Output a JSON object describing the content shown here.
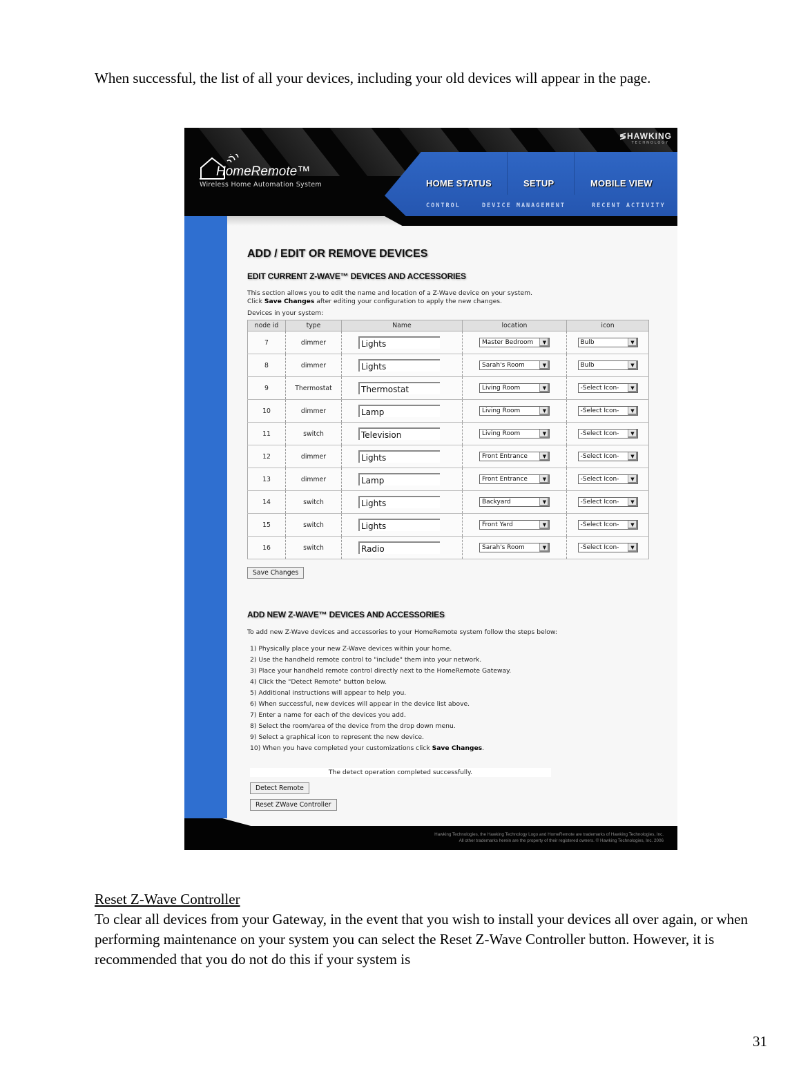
{
  "document": {
    "intro": "When successful, the list of all your devices, including your old devices will appear in the page.",
    "reset_heading": "Reset Z-Wave Controller",
    "reset_body": "To clear all devices from your Gateway, in the event that you wish to install your devices all over again, or when performing maintenance on your system you can select the Reset Z-Wave Controller button.  However, it is recommended that you do not do this if your system is",
    "page_number": "31"
  },
  "app": {
    "brand": "HAWKING",
    "brand_sub": "TECHNOLOGY",
    "logo": "HomeRemote™",
    "tagline": "Wireless Home Automation System",
    "nav": [
      {
        "label": "HOME STATUS",
        "sub": "CONTROL"
      },
      {
        "label": "SETUP",
        "sub": "DEVICE MANAGEMENT"
      },
      {
        "label": "MOBILE VIEW",
        "sub": "RECENT ACTIVITY"
      }
    ],
    "page_title": "ADD / EDIT OR REMOVE DEVICES",
    "edit_section": {
      "heading": "EDIT CURRENT Z-WAVE™ DEVICES AND ACCESSORIES",
      "desc_line1": "This section allows you to edit the name and location of a Z-Wave device on your system.",
      "desc_click": "Click ",
      "desc_bold": "Save Changes",
      "desc_rest": " after editing your configuration to apply the new changes.",
      "devices_label": "Devices in your system:",
      "columns": [
        "node id",
        "type",
        "Name",
        "location",
        "icon"
      ],
      "rows": [
        {
          "node": "7",
          "type": "dimmer",
          "name": "Lights",
          "location": "Master Bedroom",
          "icon": "Bulb"
        },
        {
          "node": "8",
          "type": "dimmer",
          "name": "Lights",
          "location": "Sarah's Room",
          "icon": "Bulb"
        },
        {
          "node": "9",
          "type": "Thermostat",
          "name": "Thermostat",
          "location": "Living Room",
          "icon": "-Select Icon-"
        },
        {
          "node": "10",
          "type": "dimmer",
          "name": "Lamp",
          "location": "Living Room",
          "icon": "-Select Icon-"
        },
        {
          "node": "11",
          "type": "switch",
          "name": "Television",
          "location": "Living Room",
          "icon": "-Select Icon-"
        },
        {
          "node": "12",
          "type": "dimmer",
          "name": "Lights",
          "location": "Front Entrance",
          "icon": "-Select Icon-"
        },
        {
          "node": "13",
          "type": "dimmer",
          "name": "Lamp",
          "location": "Front Entrance",
          "icon": "-Select Icon-"
        },
        {
          "node": "14",
          "type": "switch",
          "name": "Lights",
          "location": "Backyard",
          "icon": "-Select Icon-"
        },
        {
          "node": "15",
          "type": "switch",
          "name": "Lights",
          "location": "Front Yard",
          "icon": "-Select Icon-"
        },
        {
          "node": "16",
          "type": "switch",
          "name": "Radio",
          "location": "Sarah's Room",
          "icon": "-Select Icon-"
        }
      ],
      "save_button": "Save Changes"
    },
    "add_section": {
      "heading": "ADD NEW Z-WAVE™ DEVICES AND ACCESSORIES",
      "intro": "To add new Z-Wave devices and accessories to your HomeRemote system follow the steps below:",
      "steps": [
        "1) Physically place your new Z-Wave devices within your home.",
        "2) Use the handheld remote control to \"include\" them into your network.",
        "3) Place your handheld remote control directly next to the HomeRemote Gateway.",
        "4) Click the \"Detect Remote\" button below.",
        "5) Additional instructions will appear to help you.",
        "6) When successful, new devices will appear in the device list above.",
        "7) Enter a name for each of the devices you add.",
        "8) Select the room/area of the device from the drop down menu.",
        "9) Select a graphical icon to represent the new device."
      ],
      "last_step_prefix": "10) When you have completed your customizations click ",
      "last_step_bold": "Save Changes",
      "last_step_suffix": ".",
      "status_message": "The detect operation completed successfully.",
      "detect_button": "Detect Remote",
      "reset_button": "Reset ZWave Controller"
    },
    "footer_line1": "Hawking Technologies, the Hawking Technology Logo and HomeRemote are trademarks of Hawking Technologies, Inc.",
    "footer_line2": "All other trademarks herein are the property of their registered owners. © Hawking Technologies, Inc. 2006",
    "colors": {
      "nav_blue": "#2f66c4",
      "sidebar_blue": "#2f6fd0",
      "header_black": "#050505"
    }
  }
}
